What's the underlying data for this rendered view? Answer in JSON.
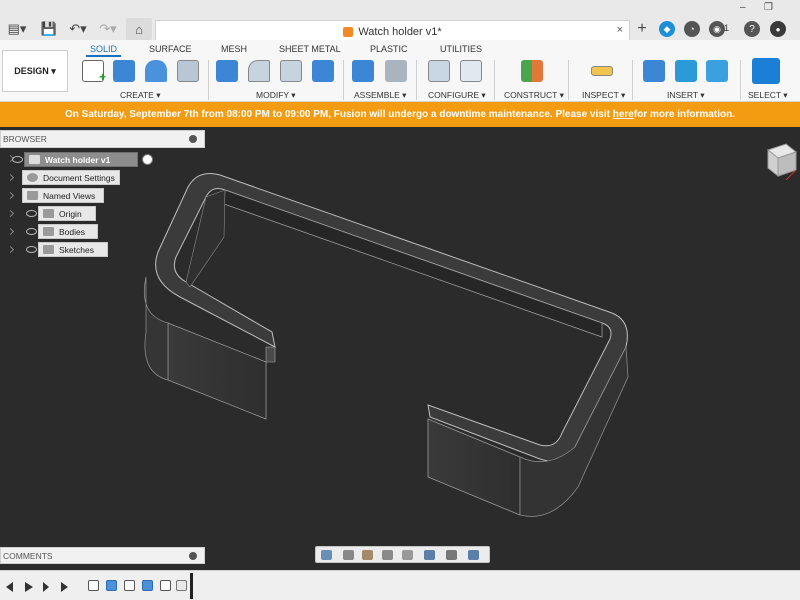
{
  "document": {
    "title": "Watch holder v1*",
    "close": "×"
  },
  "window": {
    "minimize": "–",
    "restore": "❐"
  },
  "header_right": {
    "notifications_count": "1"
  },
  "workspace": {
    "label": "DESIGN ▾"
  },
  "ribbon": {
    "tabs": [
      "SOLID",
      "SURFACE",
      "MESH",
      "SHEET METAL",
      "PLASTIC",
      "UTILITIES"
    ],
    "groups": [
      "CREATE ▾",
      "MODIFY ▾",
      "ASSEMBLE ▾",
      "CONFIGURE ▾",
      "CONSTRUCT ▾",
      "INSPECT ▾",
      "INSERT ▾",
      "SELECT ▾"
    ]
  },
  "banner": {
    "text_before": "On Saturday, September 7th from 08:00 PM to 09:00 PM, Fusion will undergo a downtime maintenance. Please visit ",
    "link": "here",
    "text_after": " for more information."
  },
  "browser": {
    "header": "BROWSER",
    "root": "Watch holder v1",
    "items": [
      "Document Settings",
      "Named Views",
      "Origin",
      "Bodies",
      "Sketches"
    ]
  },
  "comments": {
    "header": "COMMENTS"
  },
  "colors": {
    "accent": "#1a6fc2",
    "banner": "#f39c12",
    "canvas": "#2b2b2b"
  }
}
